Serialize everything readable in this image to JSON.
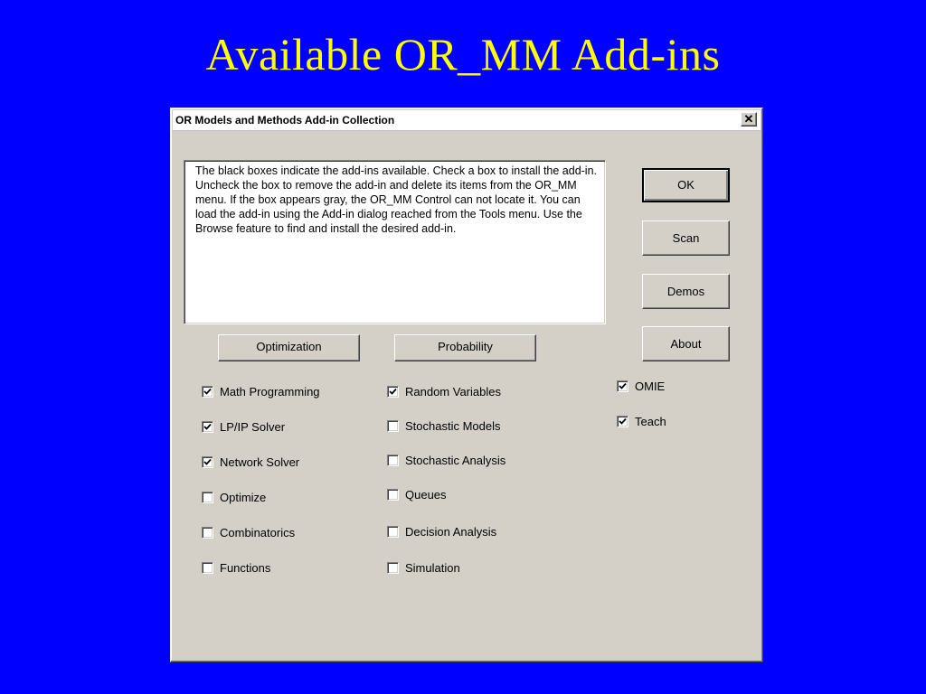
{
  "slide": {
    "title": "Available OR_MM Add-ins"
  },
  "dialog": {
    "title": "OR Models and Methods Add-in Collection",
    "close_label": "✕",
    "description": "The black boxes indicate the add-ins available. Check a box to install the add-in.  Uncheck the box to remove the add-in and delete its items from the OR_MM menu.  If the box appears gray, the OR_MM Control can not locate it. You can load the add-in using the Add-in dialog reached from the Tools menu. Use the Browse feature to find and install the desired add-in.",
    "buttons": {
      "ok": "OK",
      "scan": "Scan",
      "demos": "Demos",
      "about": "About"
    },
    "group_buttons": {
      "optimization": "Optimization",
      "probability": "Probability"
    },
    "optimization_items": [
      {
        "label": "Math Programming",
        "checked": true
      },
      {
        "label": "LP/IP Solver",
        "checked": true
      },
      {
        "label": "Network Solver",
        "checked": true
      },
      {
        "label": "Optimize",
        "checked": false
      },
      {
        "label": "Combinatorics",
        "checked": false
      },
      {
        "label": "Functions",
        "checked": false
      }
    ],
    "probability_items": [
      {
        "label": "Random Variables",
        "checked": true
      },
      {
        "label": "Stochastic Models",
        "checked": false
      },
      {
        "label": "Stochastic Analysis",
        "checked": false
      },
      {
        "label": "Queues",
        "checked": false
      },
      {
        "label": "Decision Analysis",
        "checked": false
      },
      {
        "label": "Simulation",
        "checked": false
      }
    ],
    "other_items": [
      {
        "label": "OMIE",
        "checked": true
      },
      {
        "label": "Teach",
        "checked": true
      }
    ]
  }
}
